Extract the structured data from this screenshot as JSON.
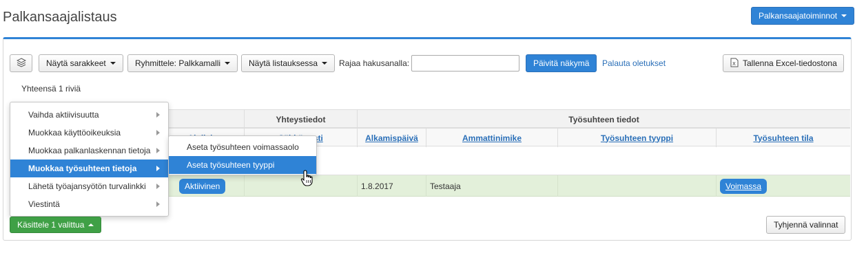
{
  "page": {
    "title": "Palkansaajalistaus"
  },
  "top_actions": {
    "label": "Palkansaajatoiminnot"
  },
  "toolbar": {
    "show_columns": "Näytä sarakkeet",
    "group_by": "Ryhmittele: Palkkamalli",
    "show_in_list": "Näytä listauksessa",
    "search_label": "Rajaa hakusanalla:",
    "search_value": "",
    "refresh": "Päivitä näkymä",
    "reset": "Palauta oletukset",
    "export": "Tallenna Excel-tiedostona"
  },
  "summary": {
    "total": "Yhteensä 1 riviä"
  },
  "table": {
    "group_headers": {
      "contact": "Yhteystiedot",
      "employment": "Työsuhteen tiedot"
    },
    "columns": {
      "activity": "Aktiivisuus",
      "email": "Sähköposti",
      "start_date": "Alkamispäivä",
      "job_title": "Ammattinimike",
      "employment_type": "Työsuhteen tyyppi",
      "employment_status": "Työsuhteen tila"
    },
    "rows": [
      {
        "activity": "Aktiivinen",
        "start_date": "1.8.2017",
        "job_title": "Testaaja",
        "status": "Voimassa"
      }
    ]
  },
  "context_menu": {
    "items": [
      "Vaihda aktiivisuutta",
      "Muokkaa käyttöoikeuksia",
      "Muokkaa palkanlaskennan tietoja",
      "Muokkaa työsuhteen tietoja",
      "Lähetä työajansyötön turvalinkki",
      "Viestintä"
    ]
  },
  "submenu": {
    "items": [
      "Aseta työsuhteen voimassaolo",
      "Aseta työsuhteen tyyppi"
    ]
  },
  "footer": {
    "process_selected": "Käsittele 1 valittua",
    "clear_selections": "Tyhjennä valinnat"
  },
  "colors": {
    "primary": "#2f83d6",
    "success": "#3fa046",
    "row_selected": "#e3f0da"
  },
  "icons": {
    "layers": "layers-icon",
    "excel": "excel-icon",
    "cursor": "hand-cursor-icon"
  }
}
